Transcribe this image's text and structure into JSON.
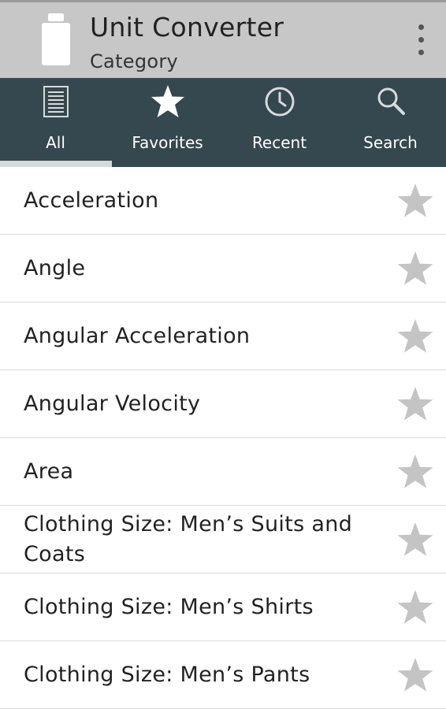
{
  "action_bar": {
    "title": "Unit Converter",
    "subtitle": "Category",
    "app_icon": "jar-icon",
    "menu_icon": "overflow-menu-icon"
  },
  "tabs": [
    {
      "label": "All",
      "icon": "list-icon",
      "selected": true
    },
    {
      "label": "Favorites",
      "icon": "star-icon",
      "selected": false
    },
    {
      "label": "Recent",
      "icon": "clock-icon",
      "selected": false
    },
    {
      "label": "Search",
      "icon": "search-icon",
      "selected": false
    }
  ],
  "categories": [
    {
      "label": "Acceleration",
      "favorite": false
    },
    {
      "label": "Angle",
      "favorite": false
    },
    {
      "label": "Angular Acceleration",
      "favorite": false
    },
    {
      "label": "Angular Velocity",
      "favorite": false
    },
    {
      "label": "Area",
      "favorite": false
    },
    {
      "label": "Clothing Size: Men’s Suits and Coats",
      "favorite": false
    },
    {
      "label": "Clothing Size: Men’s Shirts",
      "favorite": false
    },
    {
      "label": "Clothing Size: Men’s Pants",
      "favorite": false
    }
  ],
  "colors": {
    "action_bar": "#c7c7c7",
    "tab_bar": "#35474f",
    "tab_indicator": "#d7dadb",
    "star_inactive": "#c4c4c4",
    "divider": "#dcdcdc"
  }
}
